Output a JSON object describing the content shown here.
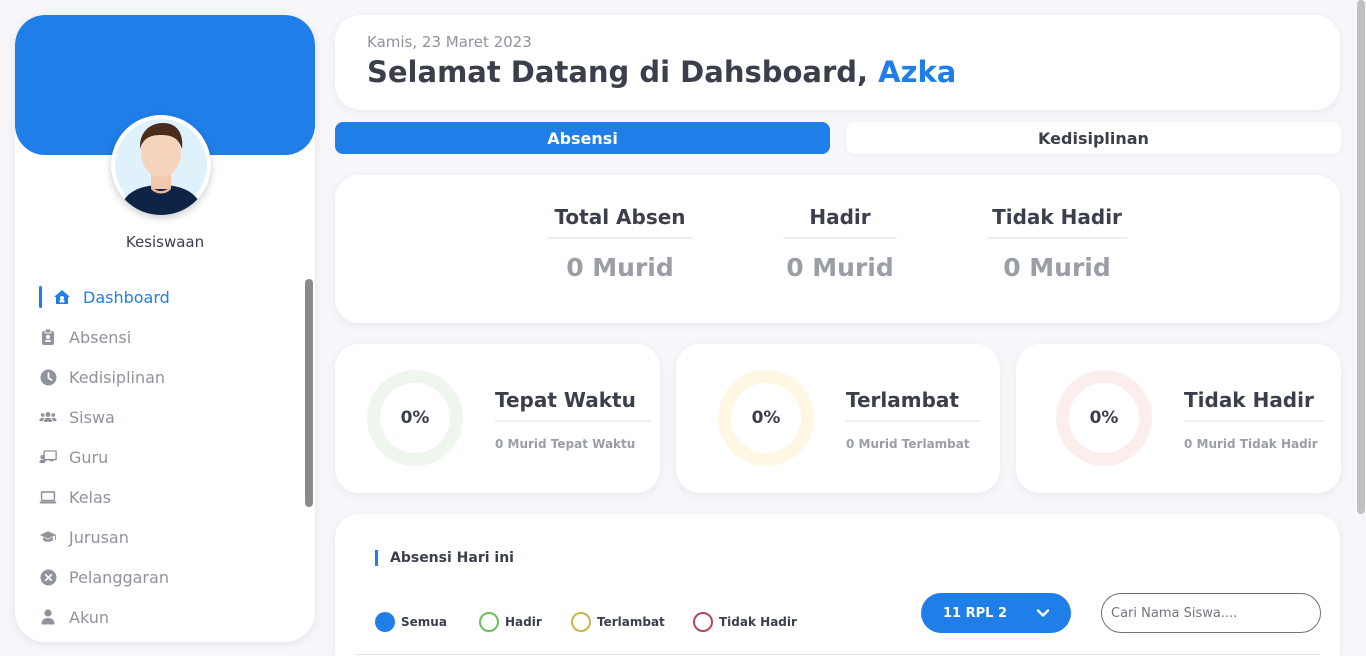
{
  "colors": {
    "accent": "#1f7ee8",
    "tepat_waktu_ring": "#eef6ee",
    "terlambat_ring": "#fdf7e3",
    "tidak_hadir_ring": "#fdeeee"
  },
  "sidebar": {
    "profile_name": "Kesiswaan",
    "avatar_icon": "user-avatar-icon",
    "items": [
      {
        "label": "Dashboard",
        "icon": "home-icon"
      },
      {
        "label": "Absensi",
        "icon": "clipboard-icon"
      },
      {
        "label": "Kedisiplinan",
        "icon": "clock-icon"
      },
      {
        "label": "Siswa",
        "icon": "users-icon"
      },
      {
        "label": "Guru",
        "icon": "teacher-icon"
      },
      {
        "label": "Kelas",
        "icon": "laptop-icon"
      },
      {
        "label": "Jurusan",
        "icon": "graduation-cap-icon"
      },
      {
        "label": "Pelanggaran",
        "icon": "x-circle-icon"
      },
      {
        "label": "Akun",
        "icon": "user-icon"
      }
    ]
  },
  "header": {
    "date": "Kamis, 23 Maret 2023",
    "welcome_prefix": "Selamat Datang di Dahsboard,",
    "username": "Azka"
  },
  "tabs": {
    "absensi": "Absensi",
    "kedisiplinan": "Kedisiplinan"
  },
  "stats": [
    {
      "title": "Total Absen",
      "value": "0 Murid"
    },
    {
      "title": "Hadir",
      "value": "0 Murid"
    },
    {
      "title": "Tidak Hadir",
      "value": "0 Murid"
    }
  ],
  "donuts": [
    {
      "percent": "0%",
      "title": "Tepat Waktu",
      "subtitle": "0 Murid Tepat Waktu"
    },
    {
      "percent": "0%",
      "title": "Terlambat",
      "subtitle": "0 Murid Terlambat"
    },
    {
      "percent": "0%",
      "title": "Tidak Hadir",
      "subtitle": "0 Murid Tidak Hadir"
    }
  ],
  "attendance": {
    "title": "Absensi Hari ini",
    "filters": [
      {
        "label": "Semua",
        "color": "#1f7ee8"
      },
      {
        "label": "Hadir",
        "color": "#6bbf59"
      },
      {
        "label": "Terlambat",
        "color": "#c8b54a"
      },
      {
        "label": "Tidak Hadir",
        "color": "#b5485a"
      }
    ],
    "class_selected": "11 RPL 2",
    "search_placeholder": "Cari Nama Siswa...."
  }
}
